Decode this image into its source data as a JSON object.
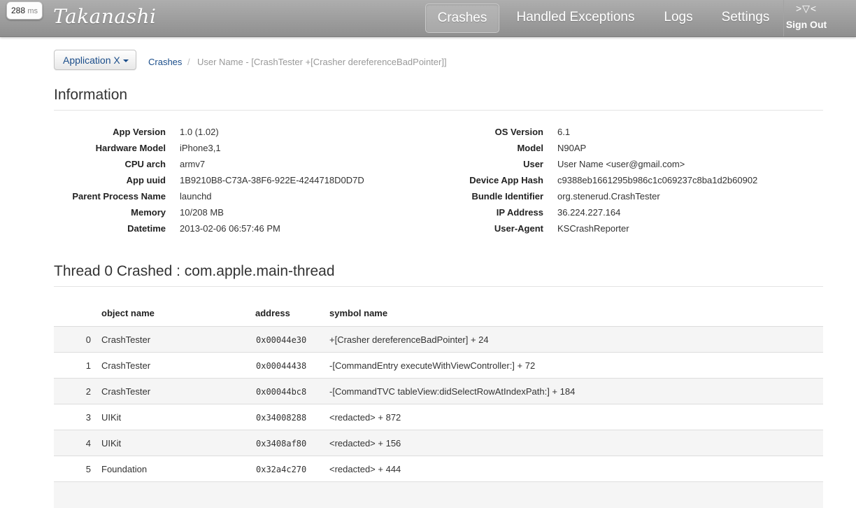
{
  "timing": {
    "value": "288",
    "unit": "ms"
  },
  "brand": "Takanashi",
  "nav": {
    "items": [
      {
        "label": "Crashes",
        "active": true
      },
      {
        "label": "Handled Exceptions",
        "active": false
      },
      {
        "label": "Logs",
        "active": false
      },
      {
        "label": "Settings",
        "active": false
      }
    ],
    "signout_glyph": ">▽<",
    "signout_label": "Sign Out"
  },
  "breadcrumb": {
    "app_button": "Application X",
    "link": "Crashes",
    "separator": "/",
    "current": "User Name - [CrashTester +[Crasher dereferenceBadPointer]]"
  },
  "information": {
    "title": "Information",
    "left": [
      {
        "label": "App Version",
        "value": "1.0 (1.02)"
      },
      {
        "label": "Hardware Model",
        "value": "iPhone3,1"
      },
      {
        "label": "CPU arch",
        "value": "armv7"
      },
      {
        "label": "App uuid",
        "value": "1B9210B8-C73A-38F6-922E-4244718D0D7D"
      },
      {
        "label": "Parent Process Name",
        "value": "launchd"
      },
      {
        "label": "Memory",
        "value": "10/208 MB"
      },
      {
        "label": "Datetime",
        "value": "2013-02-06 06:57:46 PM"
      }
    ],
    "right": [
      {
        "label": "OS Version",
        "value": "6.1"
      },
      {
        "label": "Model",
        "value": "N90AP"
      },
      {
        "label": "User",
        "value": "User Name <user@gmail.com>"
      },
      {
        "label": "Device App Hash",
        "value": "c9388eb1661295b986c1c069237c8ba1d2b60902"
      },
      {
        "label": "Bundle Identifier",
        "value": "org.stenerud.CrashTester"
      },
      {
        "label": "IP Address",
        "value": "36.224.227.164"
      },
      {
        "label": "User-Agent",
        "value": "KSCrashReporter"
      }
    ]
  },
  "thread": {
    "title": "Thread 0 Crashed : com.apple.main-thread",
    "headers": {
      "object": "object name",
      "address": "address",
      "symbol": "symbol name"
    },
    "rows": [
      {
        "index": "0",
        "object": "CrashTester",
        "address": "0x00044e30",
        "symbol": "+[Crasher dereferenceBadPointer] + 24"
      },
      {
        "index": "1",
        "object": "CrashTester",
        "address": "0x00044438",
        "symbol": "-[CommandEntry executeWithViewController:] + 72"
      },
      {
        "index": "2",
        "object": "CrashTester",
        "address": "0x00044bc8",
        "symbol": "-[CommandTVC tableView:didSelectRowAtIndexPath:] + 184"
      },
      {
        "index": "3",
        "object": "UIKit",
        "address": "0x34008288",
        "symbol": "<redacted> + 872"
      },
      {
        "index": "4",
        "object": "UIKit",
        "address": "0x3408af80",
        "symbol": "<redacted> + 156"
      },
      {
        "index": "5",
        "object": "Foundation",
        "address": "0x32a4c270",
        "symbol": "<redacted> + 444"
      }
    ]
  }
}
